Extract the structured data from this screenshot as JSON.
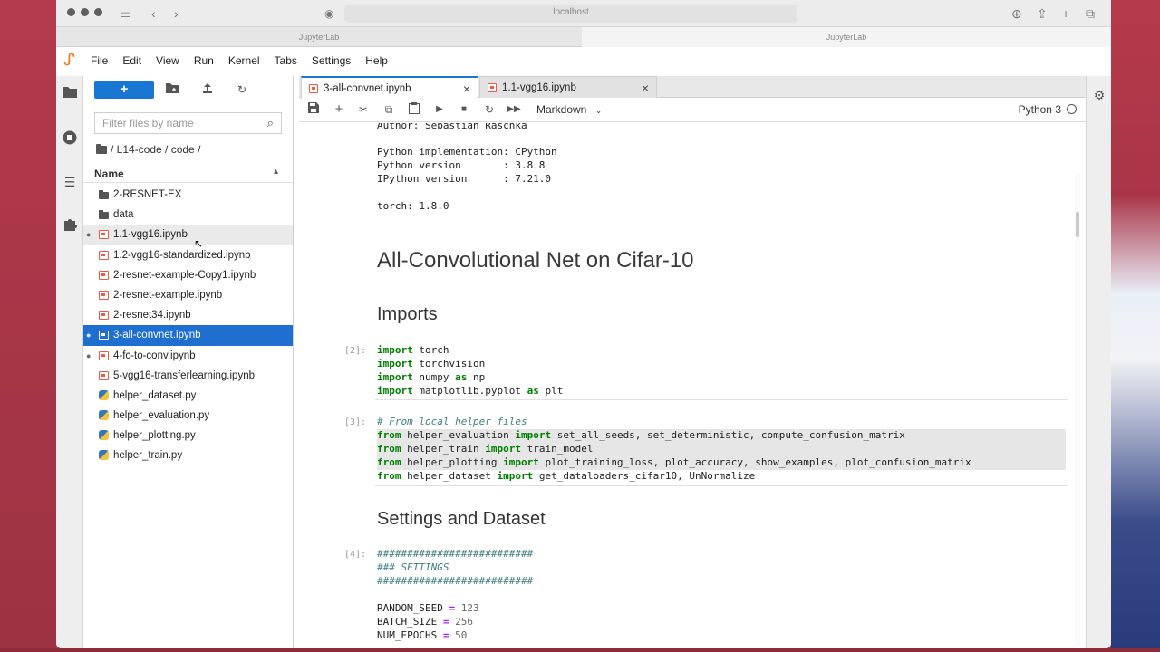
{
  "browser": {
    "url": "localhost",
    "tabs": [
      "JupyterLab",
      "JupyterLab"
    ]
  },
  "menu": [
    "File",
    "Edit",
    "View",
    "Run",
    "Kernel",
    "Tabs",
    "Settings",
    "Help"
  ],
  "filebrowser": {
    "new_label": "+",
    "search_placeholder": "Filter files by name",
    "breadcrumb": "/ L14-code / code /",
    "column_name": "Name",
    "files": [
      {
        "name": "2-RESNET-EX",
        "type": "folder",
        "running": false,
        "state": ""
      },
      {
        "name": "data",
        "type": "folder",
        "running": false,
        "state": ""
      },
      {
        "name": "1.1-vgg16.ipynb",
        "type": "notebook",
        "running": true,
        "state": "hover"
      },
      {
        "name": "1.2-vgg16-standardized.ipynb",
        "type": "notebook",
        "running": false,
        "state": ""
      },
      {
        "name": "2-resnet-example-Copy1.ipynb",
        "type": "notebook",
        "running": false,
        "state": ""
      },
      {
        "name": "2-resnet-example.ipynb",
        "type": "notebook",
        "running": false,
        "state": ""
      },
      {
        "name": "2-resnet34.ipynb",
        "type": "notebook",
        "running": false,
        "state": ""
      },
      {
        "name": "3-all-convnet.ipynb",
        "type": "notebook",
        "running": true,
        "state": "selected"
      },
      {
        "name": "4-fc-to-conv.ipynb",
        "type": "notebook",
        "running": true,
        "state": ""
      },
      {
        "name": "5-vgg16-transferlearning.ipynb",
        "type": "notebook",
        "running": false,
        "state": ""
      },
      {
        "name": "helper_dataset.py",
        "type": "python",
        "running": false,
        "state": ""
      },
      {
        "name": "helper_evaluation.py",
        "type": "python",
        "running": false,
        "state": ""
      },
      {
        "name": "helper_plotting.py",
        "type": "python",
        "running": false,
        "state": ""
      },
      {
        "name": "helper_train.py",
        "type": "python",
        "running": false,
        "state": ""
      }
    ]
  },
  "doc_tabs": [
    {
      "title": "3-all-convnet.ipynb",
      "active": true
    },
    {
      "title": "1.1-vgg16.ipynb",
      "active": false
    }
  ],
  "toolbar": {
    "cell_type": "Markdown",
    "kernel": "Python 3"
  },
  "notebook": {
    "author_line": "Author: Sebastian Raschka",
    "version_lines": [
      "Python implementation: CPython",
      "Python version       : 3.8.8",
      "IPython version      : 7.21.0",
      "",
      "torch: 1.8.0"
    ],
    "title": "All-Convolutional Net on Cifar-10",
    "imports_heading": "Imports",
    "cell2_prompt": "[2]:",
    "cell3_prompt": "[3]:",
    "cell4_prompt": "[4]:",
    "settings_heading": "Settings and Dataset"
  }
}
